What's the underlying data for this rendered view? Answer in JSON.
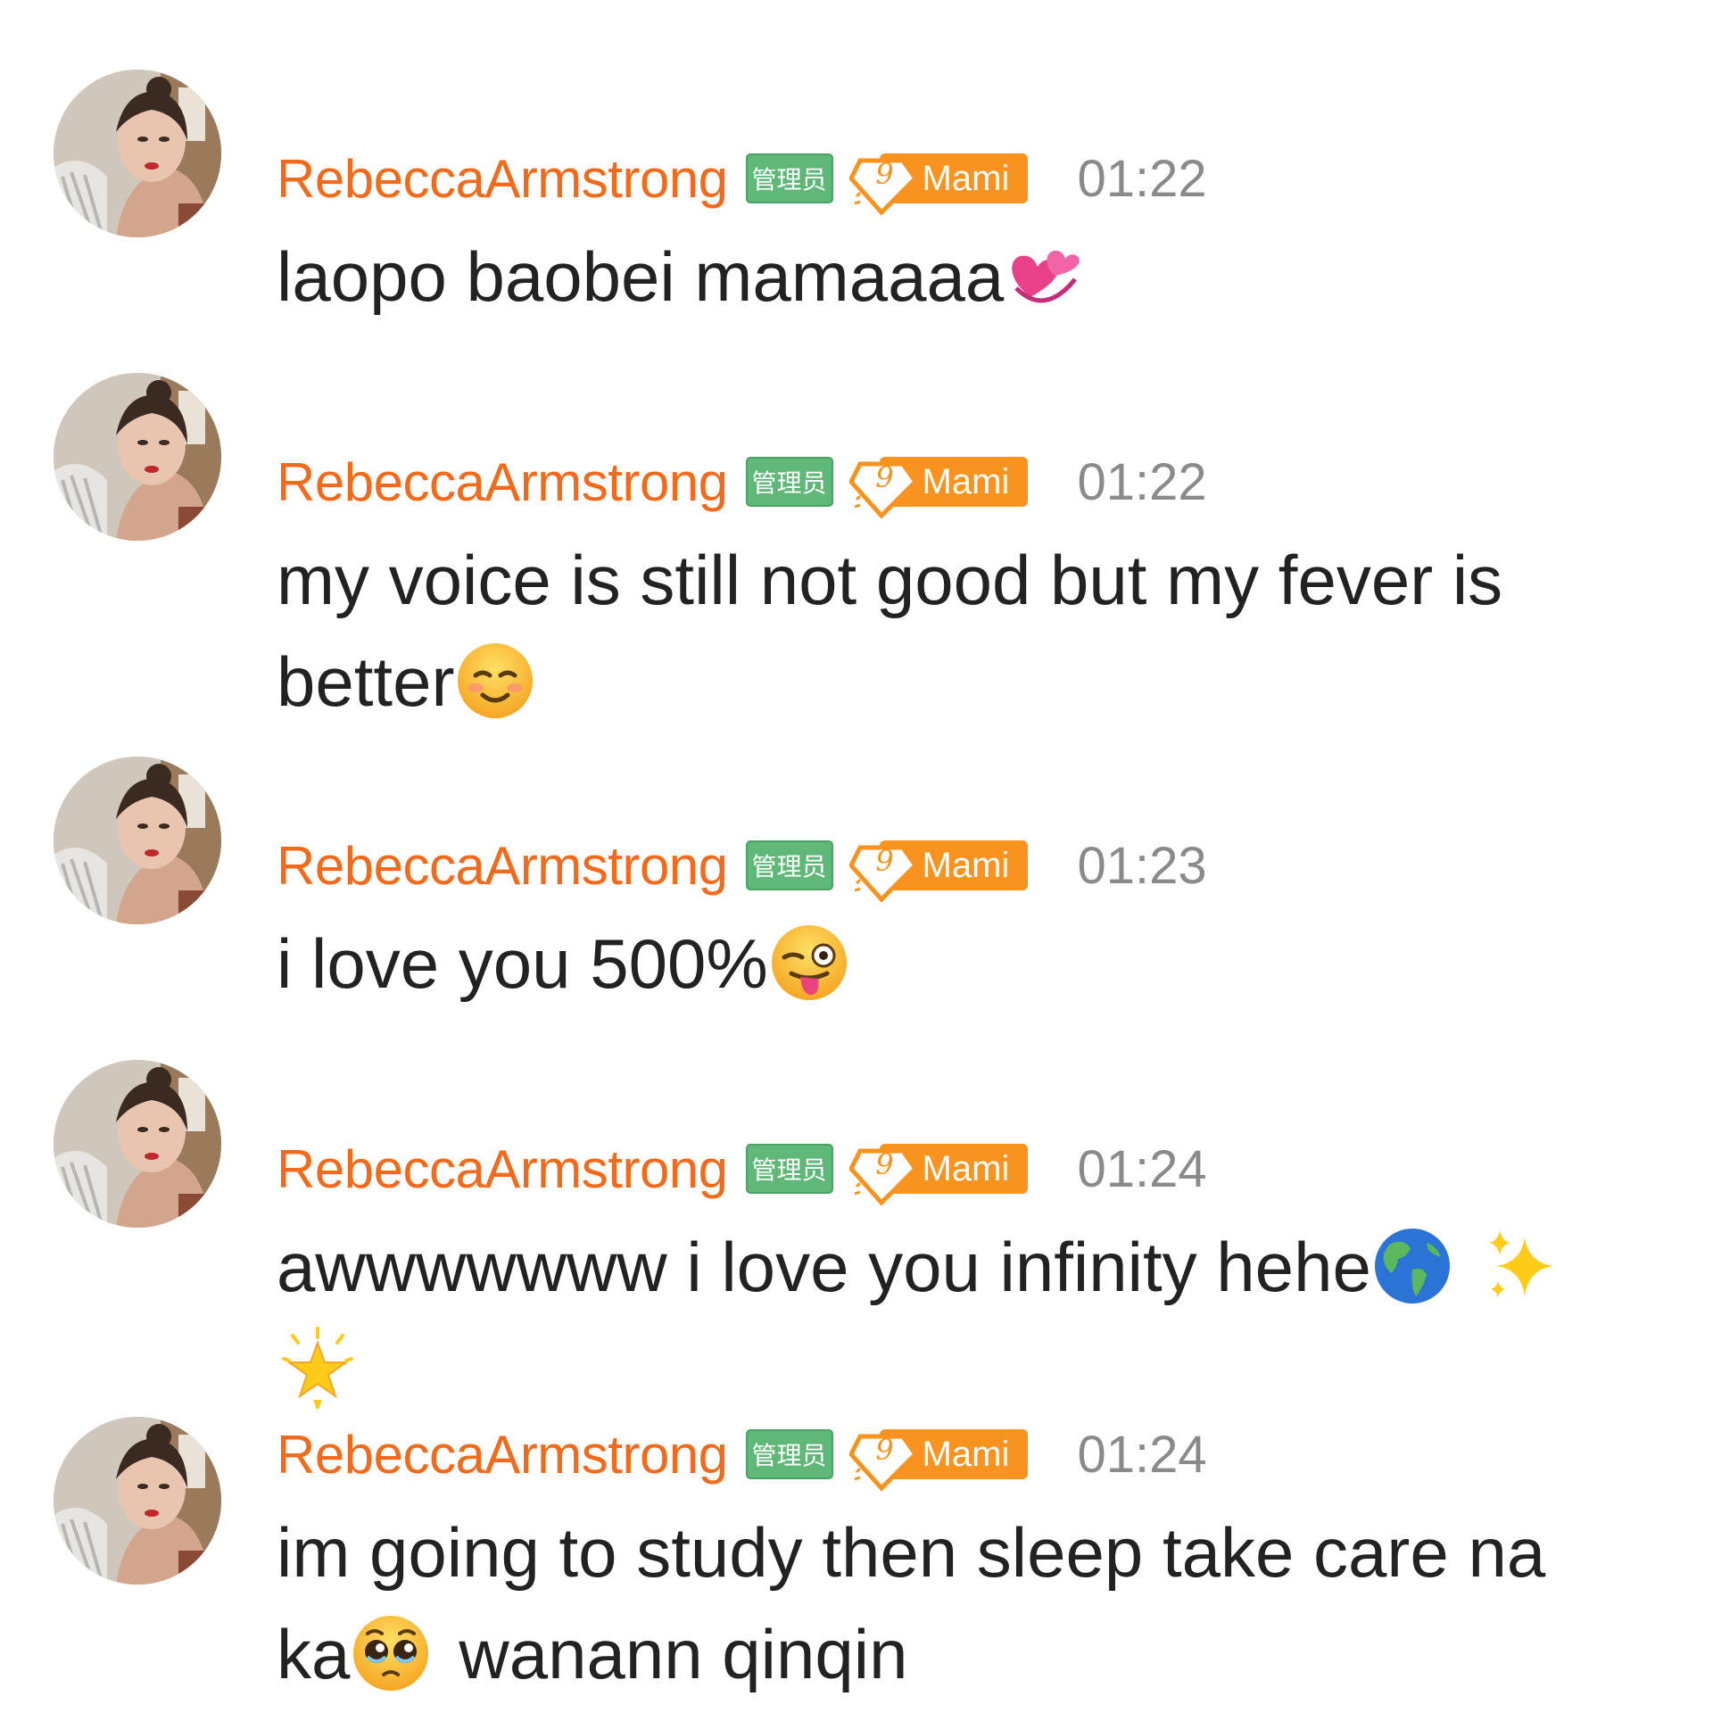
{
  "messages": [
    {
      "username": "RebeccaArmstrong",
      "admin_badge": "管理员",
      "level": "9",
      "level_name": "Mami",
      "time": "01:22",
      "text": "laopo baobei mamaaaa",
      "emojis": [
        "revolving-hearts-icon"
      ]
    },
    {
      "username": "RebeccaArmstrong",
      "admin_badge": "管理员",
      "level": "9",
      "level_name": "Mami",
      "time": "01:22",
      "text_line1": "my voice is still not good but my fever is",
      "text_line2": "better",
      "emojis": [
        "smiling-face-icon"
      ]
    },
    {
      "username": "RebeccaArmstrong",
      "admin_badge": "管理员",
      "level": "9",
      "level_name": "Mami",
      "time": "01:23",
      "text": "i love you 500%",
      "emojis": [
        "winking-tongue-face-icon"
      ]
    },
    {
      "username": "RebeccaArmstrong",
      "admin_badge": "管理员",
      "level": "9",
      "level_name": "Mami",
      "time": "01:24",
      "text": "awwwwwww i love you infinity hehe",
      "emojis": [
        "globe-americas-icon",
        "sparkles-icon",
        "glowing-star-icon"
      ]
    },
    {
      "username": "RebeccaArmstrong",
      "admin_badge": "管理员",
      "level": "9",
      "level_name": "Mami",
      "time": "01:24",
      "text_line1": "im going to study then sleep take care na",
      "text_line2a": "ka",
      "text_line2b": "wanann qinqin",
      "emojis": [
        "pleading-face-icon"
      ]
    }
  ],
  "colors": {
    "username": "#f26b1d",
    "admin_badge": "#5fb878",
    "level_badge": "#f7931e",
    "time": "#8a8a8a",
    "text": "#222222"
  }
}
